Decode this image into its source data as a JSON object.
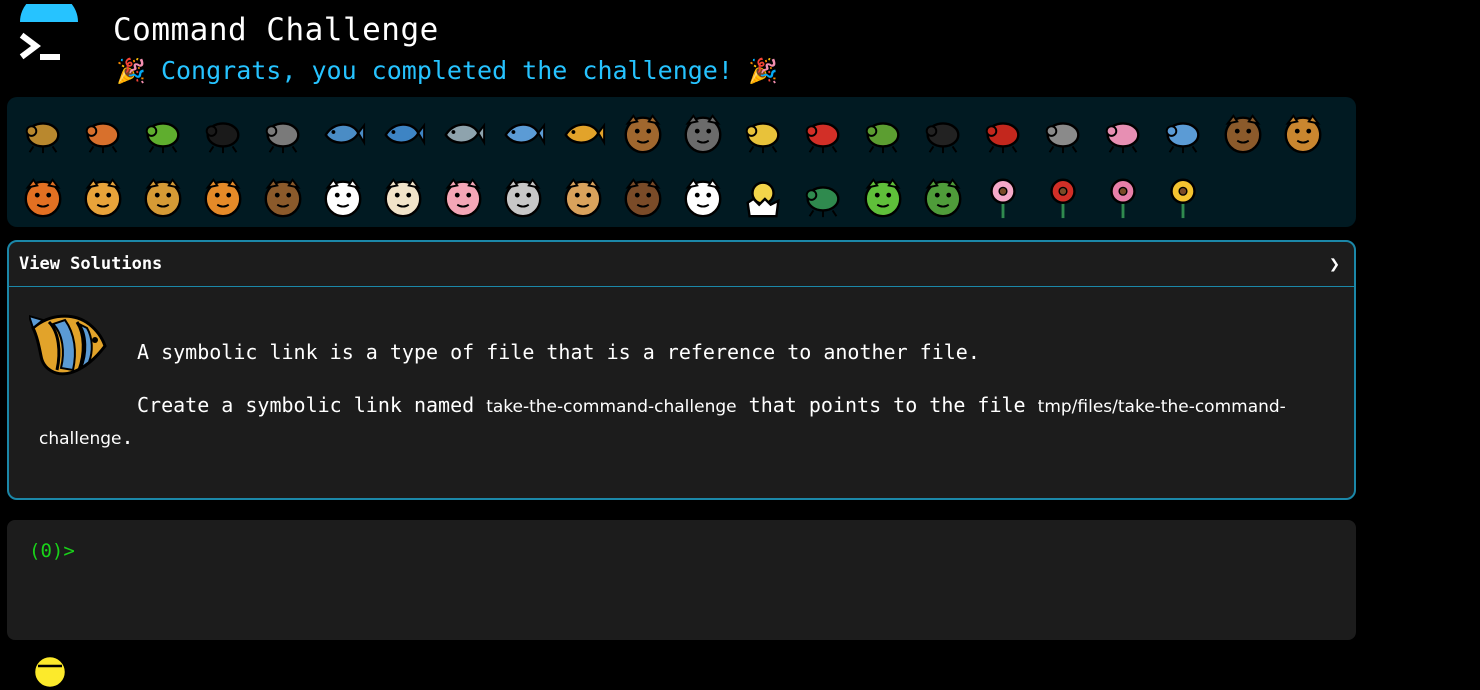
{
  "header": {
    "title": "Command Challenge",
    "congrats_text": "Congrats, you completed the challenge!",
    "congrats_emoji_left": "🎉",
    "congrats_emoji_right": "🎉",
    "accent_color": "#26c3ff"
  },
  "emoji_panel": {
    "items": [
      {
        "name": "snail",
        "fill": "#b9882e"
      },
      {
        "name": "butterfly",
        "fill": "#d8702c"
      },
      {
        "name": "caterpillar",
        "fill": "#5fae2e"
      },
      {
        "name": "ant",
        "fill": "#1a1a1a"
      },
      {
        "name": "spider-web",
        "fill": "#7a7a7a"
      },
      {
        "name": "whale",
        "fill": "#4a8cc5"
      },
      {
        "name": "whale-spouting",
        "fill": "#3d84c4"
      },
      {
        "name": "dolphin",
        "fill": "#8ea3ad"
      },
      {
        "name": "fish",
        "fill": "#5b9bd5"
      },
      {
        "name": "tropical-fish",
        "fill": "#e2a32a"
      },
      {
        "name": "blowfish",
        "fill": "#a0672e"
      },
      {
        "name": "wolf",
        "fill": "#6b6b6b"
      },
      {
        "name": "honeybee",
        "fill": "#e8c23a"
      },
      {
        "name": "lady-beetle",
        "fill": "#d22f27"
      },
      {
        "name": "cricket",
        "fill": "#5c9e31"
      },
      {
        "name": "spider",
        "fill": "#222222"
      },
      {
        "name": "scorpion",
        "fill": "#c3271d"
      },
      {
        "name": "fly",
        "fill": "#8a8a8a"
      },
      {
        "name": "worm",
        "fill": "#e78fb3"
      },
      {
        "name": "microbe",
        "fill": "#5b9bd5"
      },
      {
        "name": "monkey-face",
        "fill": "#8b5a2b"
      },
      {
        "name": "dog-face",
        "fill": "#c9862f"
      },
      {
        "name": "fox-face",
        "fill": "#e27022"
      },
      {
        "name": "cat-face",
        "fill": "#e8a33a"
      },
      {
        "name": "lion-face",
        "fill": "#d59a35"
      },
      {
        "name": "tiger-face",
        "fill": "#e58a28"
      },
      {
        "name": "horse-face",
        "fill": "#8b5a2b"
      },
      {
        "name": "unicorn-face",
        "fill": "#ffffff"
      },
      {
        "name": "cow-face",
        "fill": "#f1e3c9"
      },
      {
        "name": "pig-face",
        "fill": "#f4a6b6"
      },
      {
        "name": "mouse-face",
        "fill": "#c7c7c7"
      },
      {
        "name": "hamster-face",
        "fill": "#d9a25c"
      },
      {
        "name": "bear-face",
        "fill": "#7a4b28"
      },
      {
        "name": "panda-face",
        "fill": "#ffffff"
      },
      {
        "name": "hatching-chick",
        "fill": "#f3d54a"
      },
      {
        "name": "peacock",
        "fill": "#2f8a4e"
      },
      {
        "name": "frog-face",
        "fill": "#5fbf3a"
      },
      {
        "name": "dragon-face",
        "fill": "#4f9c3a"
      },
      {
        "name": "cherry-blossom",
        "fill": "#f6a9c8"
      },
      {
        "name": "rose",
        "fill": "#d22f27"
      },
      {
        "name": "hibiscus",
        "fill": "#e87fa9"
      },
      {
        "name": "sunflower",
        "fill": "#f4c430"
      }
    ]
  },
  "solutions": {
    "title": "View Solutions",
    "chevron": "❯",
    "description": "A symbolic link is a type of file that is a reference to another file.",
    "task_prefix": "Create a symbolic link named",
    "task_link_name": "take-the-command-challenge",
    "task_middle": "that points to the file",
    "task_target": "tmp/files/take-the-command-challenge",
    "task_suffix": "."
  },
  "terminal": {
    "prompt": "(0)>"
  }
}
